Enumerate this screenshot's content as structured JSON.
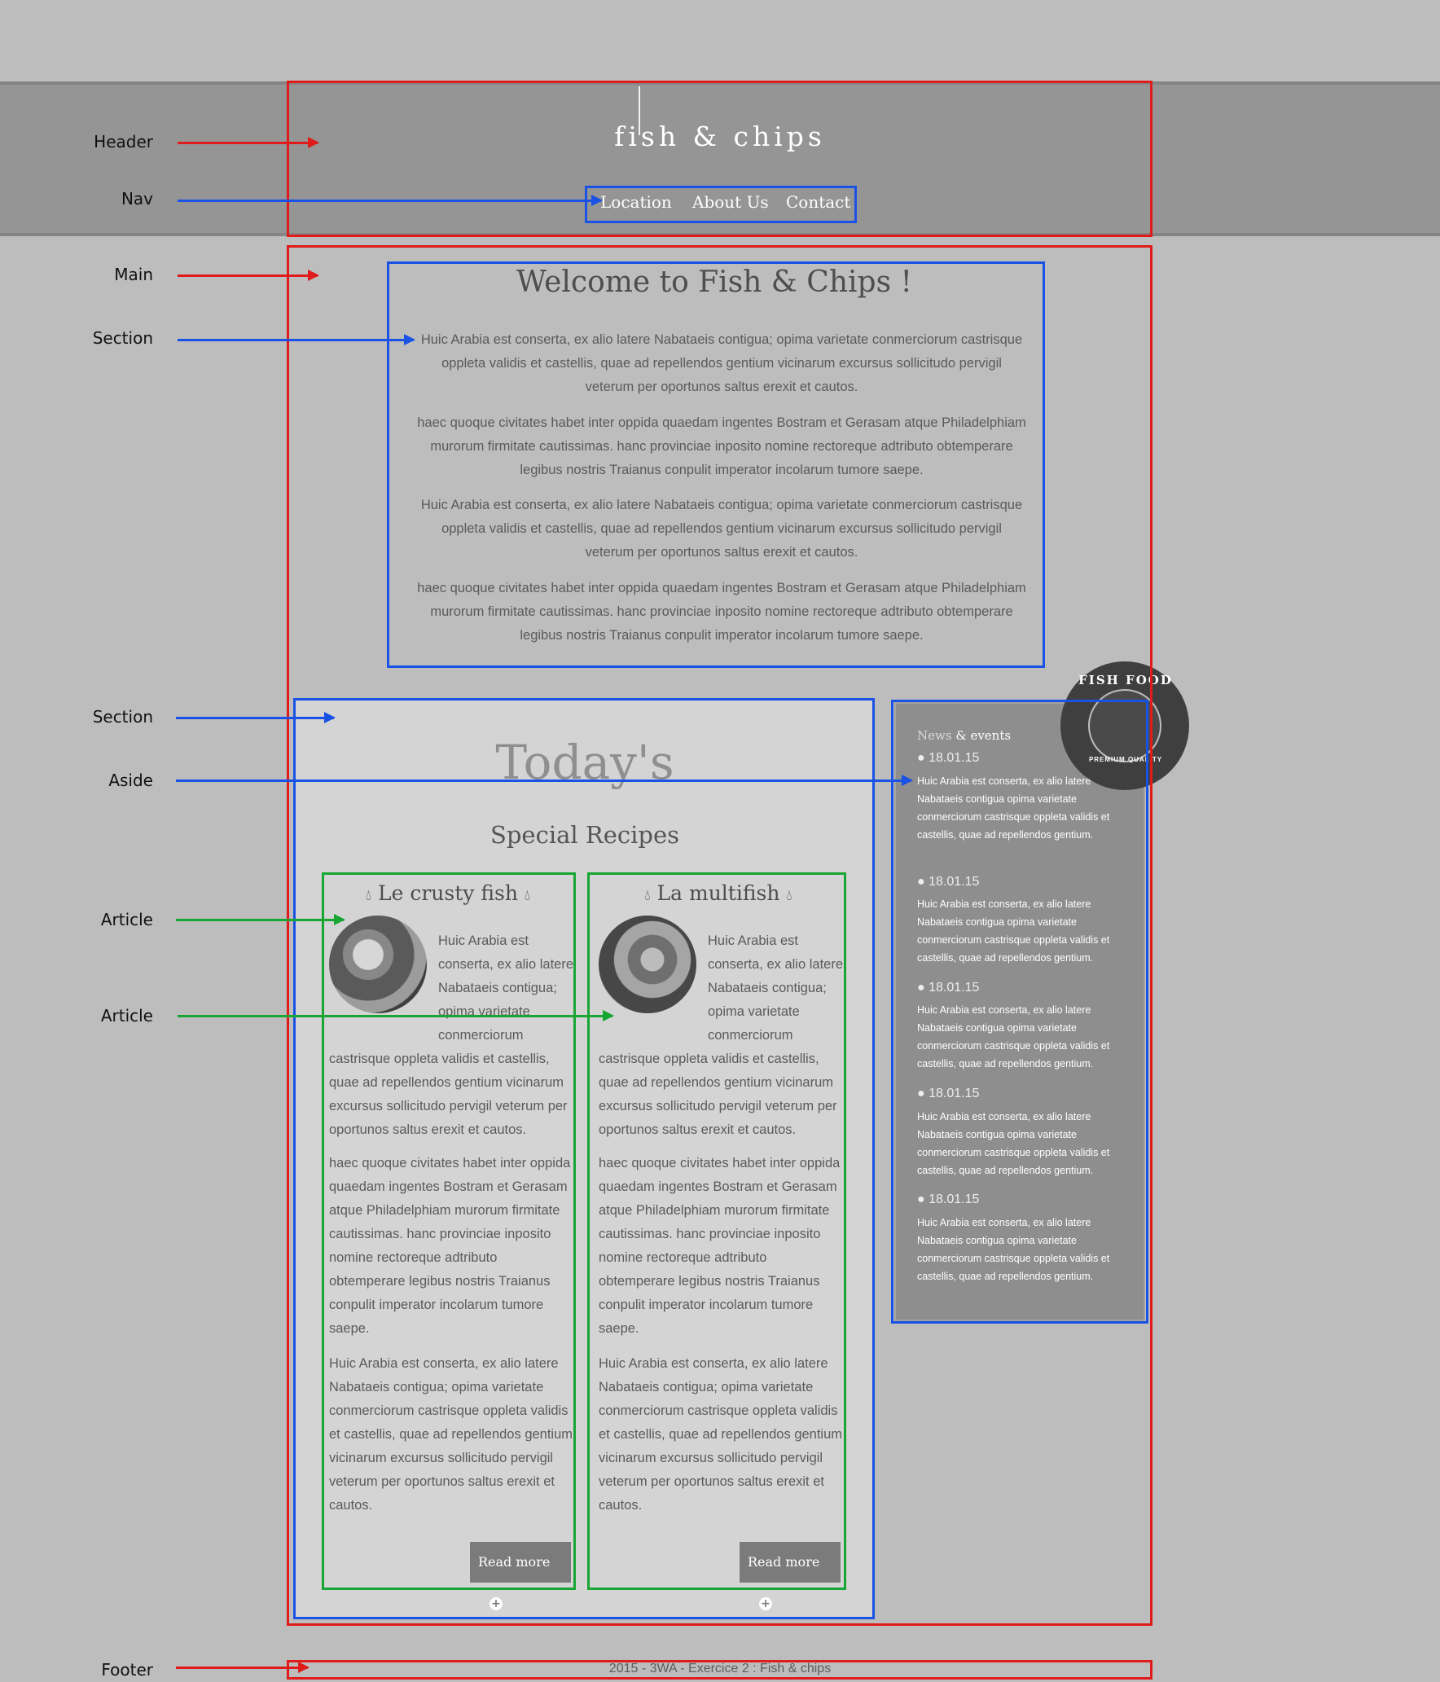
{
  "header": {
    "logo": "fish & chips",
    "nav": [
      "Location",
      "About Us",
      "Contact"
    ]
  },
  "annotations": {
    "header": "Header",
    "nav": "Nav",
    "main": "Main",
    "section1": "Section",
    "section2": "Section",
    "aside": "Aside",
    "article1": "Article",
    "article2": "Article",
    "footer": "Footer"
  },
  "welcome": {
    "title": "Welcome to Fish & Chips !",
    "paragraphs": [
      "Huic Arabia est conserta, ex alio latere Nabataeis contigua; opima varietate conmerciorum castrisque oppleta validis et castellis, quae ad repellendos gentium vicinarum excursus sollicitudo pervigil veterum per oportunos saltus erexit et cautos.",
      "haec quoque civitates habet inter oppida quaedam ingentes Bostram et Gerasam atque Philadelphiam murorum firmitate cautissimas. hanc provinciae inposito nomine rectoreque adtributo obtemperare legibus nostris Traianus conpulit imperator incolarum tumore saepe.",
      "Huic Arabia est conserta, ex alio latere Nabataeis contigua; opima varietate conmerciorum castrisque oppleta validis et castellis, quae ad repellendos gentium vicinarum excursus sollicitudo pervigil veterum per oportunos saltus erexit et cautos.",
      "haec quoque civitates habet inter oppida quaedam ingentes Bostram et Gerasam atque Philadelphiam murorum firmitate cautissimas. hanc provinciae inposito nomine rectoreque adtributo obtemperare legibus nostris Traianus conpulit imperator incolarum tumore saepe."
    ]
  },
  "recipes": {
    "todays": "Today's",
    "special": "Special Recipes",
    "articles": [
      {
        "title": "Le crusty fish",
        "intro": "Huic Arabia est conserta, ex alio latere Nabataeis contigua; opima varietate conmerciorum castrisque oppleta validis et castellis, quae ad repellendos gentium vicinarum excursus sollicitudo pervigil veterum per oportunos saltus erexit et cautos.",
        "p2": "haec quoque civitates habet inter oppida quaedam ingentes Bostram et Gerasam atque Philadelphiam murorum firmitate cautissimas. hanc provinciae inposito nomine rectoreque adtributo obtemperare legibus nostris Traianus conpulit imperator incolarum tumore saepe.",
        "p3": "Huic Arabia est conserta, ex alio latere Nabataeis contigua; opima varietate conmerciorum castrisque oppleta validis et castellis, quae ad repellendos gentium vicinarum excursus sollicitudo pervigil veterum per oportunos saltus erexit et cautos.",
        "button": "Read more"
      },
      {
        "title": "La multifish",
        "intro": "Huic Arabia est conserta, ex alio latere Nabataeis contigua; opima varietate conmerciorum castrisque oppleta validis et castellis, quae ad repellendos gentium vicinarum excursus sollicitudo pervigil veterum per oportunos saltus erexit et cautos.",
        "p2": "haec quoque civitates habet inter oppida quaedam ingentes Bostram et Gerasam atque Philadelphiam murorum firmitate cautissimas. hanc provinciae inposito nomine rectoreque adtributo obtemperare legibus nostris Traianus conpulit imperator incolarum tumore saepe.",
        "p3": "Huic Arabia est conserta, ex alio latere Nabataeis contigua; opima varietate conmerciorum castrisque oppleta validis et castellis, quae ad repellendos gentium vicinarum excursus sollicitudo pervigil veterum per oportunos saltus erexit et cautos.",
        "button": "Read more"
      }
    ]
  },
  "aside": {
    "heading_muted": "News",
    "heading": "& events",
    "items": [
      {
        "date": "18.01.15",
        "text": "Huic Arabia est conserta, ex alio latere Nabataeis contigua opima varietate conmerciorum castrisque oppleta validis et castellis, quae ad repellendos gentium."
      },
      {
        "date": "18.01.15",
        "text": "Huic Arabia est conserta, ex alio latere Nabataeis contigua opima varietate conmerciorum castrisque oppleta validis et castellis, quae ad repellendos gentium."
      },
      {
        "date": "18.01.15",
        "text": "Huic Arabia est conserta, ex alio latere Nabataeis contigua opima varietate conmerciorum castrisque oppleta validis et castellis, quae ad repellendos gentium."
      },
      {
        "date": "18.01.15",
        "text": "Huic Arabia est conserta, ex alio latere Nabataeis contigua opima varietate conmerciorum castrisque oppleta validis et castellis, quae ad repellendos gentium."
      },
      {
        "date": "18.01.15",
        "text": "Huic Arabia est conserta, ex alio latere Nabataeis contigua opima varietate conmerciorum castrisque oppleta validis et castellis, quae ad repellendos gentium."
      }
    ],
    "badge_top": "FISH FOOD",
    "badge_bottom": "PREMIUM QUALITY"
  },
  "footer": {
    "text": "2015 - 3WA - Exercice 2 : Fish & chips"
  },
  "colors": {
    "annotation_red": "#e01b1b",
    "annotation_blue": "#1a52e6",
    "annotation_green": "#17a633"
  }
}
